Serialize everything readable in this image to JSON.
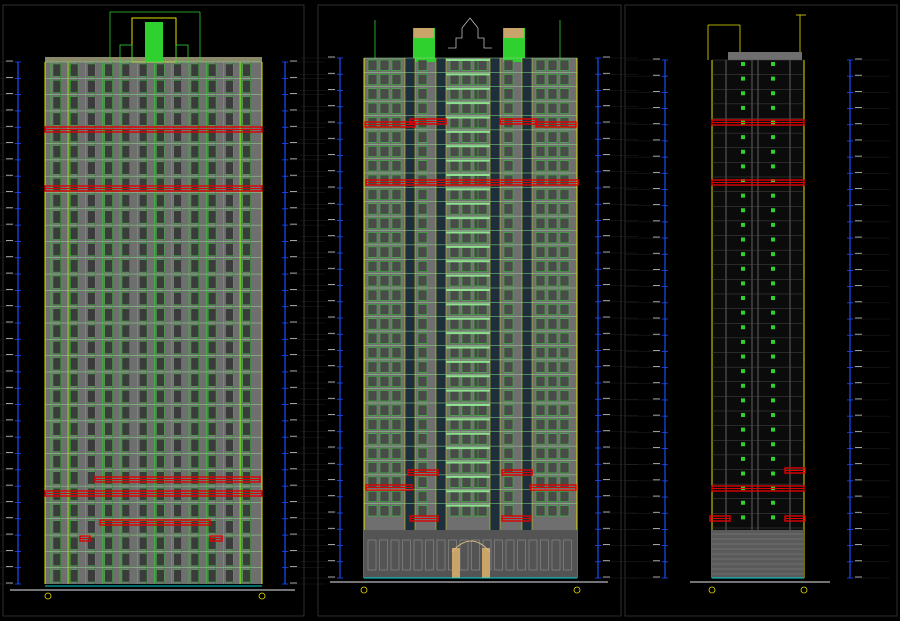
{
  "drawing": {
    "background": "#000000",
    "colors": {
      "wall_fill": "#6f6f6f",
      "window_green": "#2fd12f",
      "window_light": "#8fe08f",
      "outline_yellow": "#e8e000",
      "red_band": "#e00000",
      "blue_axis": "#1a4dff",
      "white_text": "#e8e8e8",
      "cyan_ground": "#00d8d8",
      "frame_border": "#3a3a3a"
    },
    "views": [
      {
        "id": "left-elevation",
        "title": "",
        "floors": 32
      },
      {
        "id": "center-elevation",
        "title": "",
        "floors": 32
      },
      {
        "id": "side-elevation",
        "title": "",
        "floors": 32
      }
    ]
  }
}
